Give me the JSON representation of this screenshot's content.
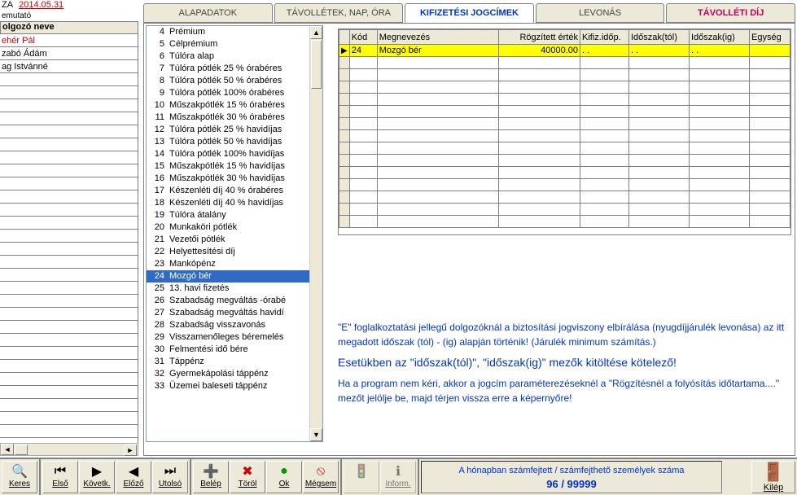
{
  "header": {
    "za": "ZA",
    "date": "2014.05.31",
    "sub": "emutató",
    "col_header": "olgozó neve"
  },
  "employees": [
    {
      "name": "ehér Pál",
      "selected": true
    },
    {
      "name": "zabó Ádám",
      "selected": false
    },
    {
      "name": "ag Istvánné",
      "selected": false
    }
  ],
  "tabs": [
    {
      "label": "ALAPADATOK",
      "active": false
    },
    {
      "label": "TÁVOLLÉTEK, NAP, ÓRA",
      "active": false
    },
    {
      "label": "KIFIZETÉSI JOGCÍMEK",
      "active": true
    },
    {
      "label": "LEVONÁS",
      "active": false
    },
    {
      "label": "TÁVOLLÉTI DÍJ",
      "active": false,
      "red": true
    }
  ],
  "codes": [
    {
      "n": 4,
      "t": "Prémium"
    },
    {
      "n": 5,
      "t": "Célprémium"
    },
    {
      "n": 6,
      "t": "Túlóra alap"
    },
    {
      "n": 7,
      "t": "Túlóra pótlék 25 % órabéres"
    },
    {
      "n": 8,
      "t": "Túlóra pótlék 50 % órabéres"
    },
    {
      "n": 9,
      "t": "Túlóra pótlék 100% órabéres"
    },
    {
      "n": 10,
      "t": "Műszakpótlék 15 % órabéres"
    },
    {
      "n": 11,
      "t": "Műszakpótlék 30 % órabéres"
    },
    {
      "n": 12,
      "t": "Túlóra pótlék 25 % havidíjas"
    },
    {
      "n": 13,
      "t": "Túlóra pótlék 50 % havidíjas"
    },
    {
      "n": 14,
      "t": "Túlóra pótlék 100% havidíjas"
    },
    {
      "n": 15,
      "t": "Műszakpótlék 15 % havidíjas"
    },
    {
      "n": 16,
      "t": "Műszakpótlék 30 % havidíjas"
    },
    {
      "n": 17,
      "t": "Készenléti díj 40 % órabéres"
    },
    {
      "n": 18,
      "t": "Készenléti díj 40 % havidíjas"
    },
    {
      "n": 19,
      "t": "Túlóra átalány"
    },
    {
      "n": 20,
      "t": "Munkaköri pótlék"
    },
    {
      "n": 21,
      "t": "Vezetői pótlék"
    },
    {
      "n": 22,
      "t": "Helyettesítési díj"
    },
    {
      "n": 23,
      "t": "Mankópénz"
    },
    {
      "n": 24,
      "t": "Mozgó bér",
      "selected": true
    },
    {
      "n": 25,
      "t": "13. havi fizetés"
    },
    {
      "n": 26,
      "t": "Szabadság megváltás -órabé"
    },
    {
      "n": 27,
      "t": "Szabadság megváltás havidí"
    },
    {
      "n": 28,
      "t": "Szabadság visszavonás"
    },
    {
      "n": 29,
      "t": "Visszamenőleges béremelés"
    },
    {
      "n": 30,
      "t": "Felmentési idő bére"
    },
    {
      "n": 31,
      "t": "Táppénz"
    },
    {
      "n": 32,
      "t": "Gyermekápolási táppénz"
    },
    {
      "n": 33,
      "t": "Üzemei baleseti táppénz"
    }
  ],
  "grid": {
    "cols": [
      "Kód",
      "Megnevezés",
      "Rögzített érték",
      "Kifiz.időp.",
      "Időszak(tól)",
      "Időszak(ig)",
      "Egység"
    ],
    "row": {
      "kod": "24",
      "meg": "Mozgó bér",
      "ertek": "40000.00",
      "ido": ".  .",
      "tol": ".  .",
      "ig": ".  .",
      "egy": ""
    },
    "empty_rows": 14
  },
  "info": {
    "p1": "\"E\" foglalkoztatási jellegű dolgozóknál a biztosítási jogviszony elbírálása (nyugdíjjárulék levonása) az itt megadott időszak (tól) - (ig) alapján történik! (Járulék minimum számítás.)",
    "p2": "Esetükben az \"időszak(tól)\", \"időszak(ig)\" mezők kitöltése kötelező!",
    "p3": "Ha a program nem kéri, akkor a jogcím paraméterezéseknél a \"Rögzítésnél a folyósítás időtartama....\" mezőt jelölje be, majd térjen vissza erre a képernyőre!"
  },
  "toolbar": {
    "keres": "Keres",
    "elso": "Első",
    "kovetk": "Követk.",
    "elozo": "Előző",
    "utolso": "Utolsó",
    "belep": "Belép",
    "torol": "Töröl",
    "ok": "Ok",
    "megsem": "Mégsem",
    "inform": "Inform.",
    "status_label": "A hónapban számfejtett / számfejthető személyek száma",
    "status_count": "96 / 99999",
    "kilep": "Kilép"
  }
}
